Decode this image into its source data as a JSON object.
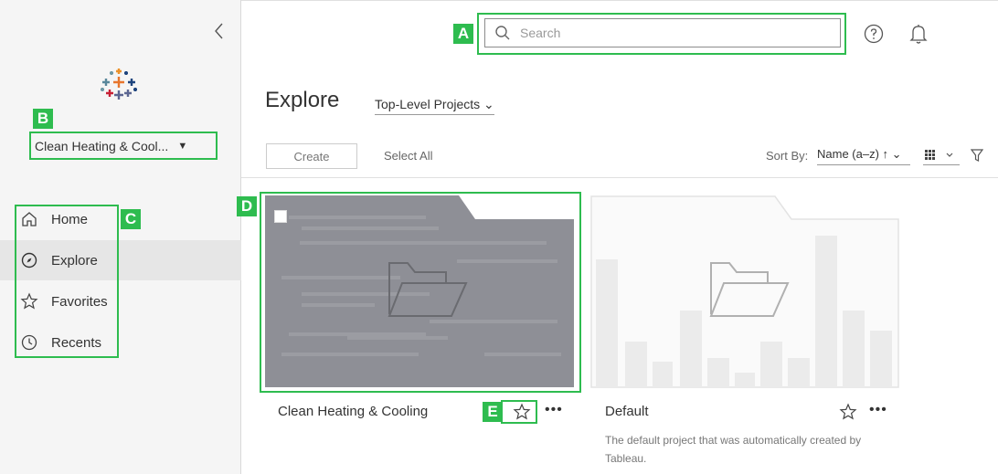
{
  "search": {
    "placeholder": "Search"
  },
  "sidebar": {
    "site_name": "Clean Heating & Cool...",
    "items": [
      {
        "label": "Home",
        "icon": "home-icon"
      },
      {
        "label": "Explore",
        "icon": "compass-icon",
        "active": true
      },
      {
        "label": "Favorites",
        "icon": "star-icon"
      },
      {
        "label": "Recents",
        "icon": "clock-icon"
      }
    ]
  },
  "main": {
    "title": "Explore",
    "project_filter": "Top-Level Projects ⌄",
    "create_label": "Create",
    "select_all_label": "Select All",
    "sort_by_label": "Sort By:",
    "sort_value": "Name (a–z) ↑ ⌄"
  },
  "cards": [
    {
      "title": "Clean Heating & Cooling",
      "more": "•••"
    },
    {
      "title": "Default",
      "more": "•••",
      "description": "The default project that was automatically created by Tableau."
    }
  ],
  "callouts": {
    "a": "A",
    "b": "B",
    "c": "C",
    "d": "D",
    "e": "E"
  },
  "colors": {
    "accent_green": "#2ebc4f",
    "sidebar_bg": "#f5f5f5",
    "card_dark": "#8e8f96"
  }
}
